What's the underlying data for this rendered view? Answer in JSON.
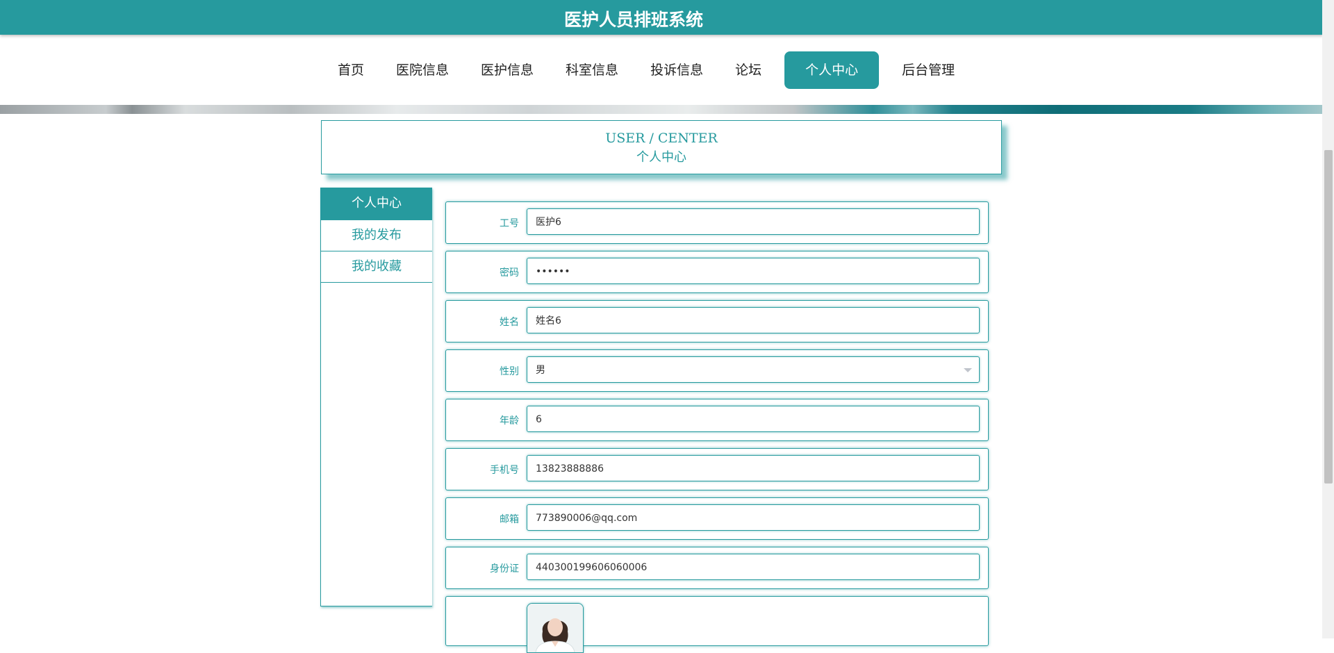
{
  "app": {
    "title": "医护人员排班系统"
  },
  "nav": {
    "items": [
      "首页",
      "医院信息",
      "医护信息",
      "科室信息",
      "投诉信息",
      "论坛",
      "个人中心",
      "后台管理"
    ],
    "active": "个人中心"
  },
  "header": {
    "en": "USER / CENTER",
    "cn": "个人中心"
  },
  "sidebar": {
    "items": [
      "个人中心",
      "我的发布",
      "我的收藏"
    ],
    "active": "个人中心"
  },
  "form": {
    "fields": [
      {
        "label": "工号",
        "value": "医护6"
      },
      {
        "label": "密码",
        "value": "••••••"
      },
      {
        "label": "姓名",
        "value": "姓名6"
      },
      {
        "label": "性别",
        "value": "男"
      },
      {
        "label": "年龄",
        "value": "6"
      },
      {
        "label": "手机号",
        "value": "13823888886"
      },
      {
        "label": "邮箱",
        "value": "773890006@qq.com"
      },
      {
        "label": "身份证",
        "value": "440300199606060006"
      }
    ]
  },
  "colors": {
    "accent": "#269a9e"
  }
}
